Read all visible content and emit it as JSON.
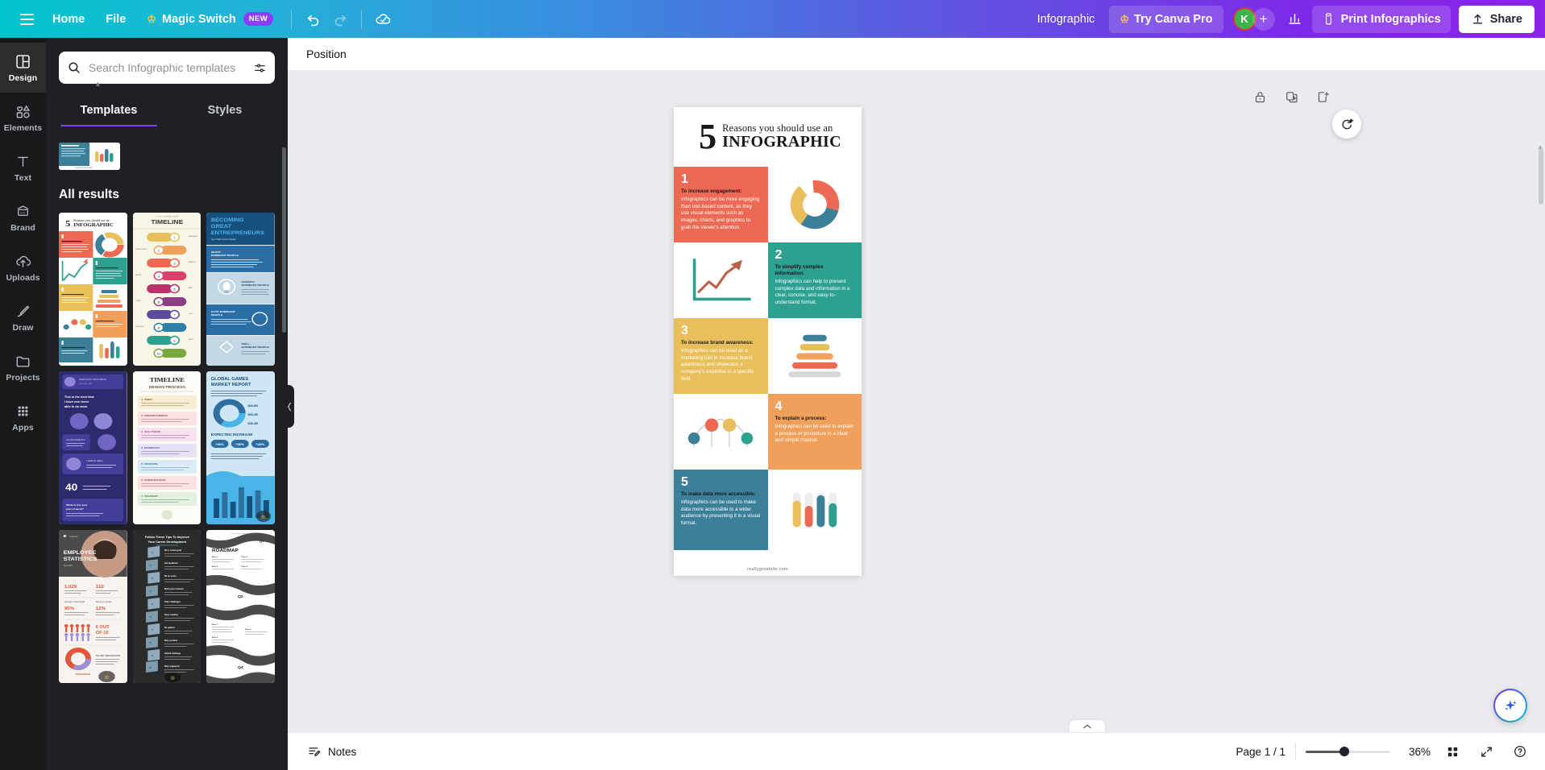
{
  "header": {
    "menu_icon": "hamburger-icon",
    "home_label": "Home",
    "file_label": "File",
    "magic_switch_label": "Magic Switch",
    "magic_switch_badge": "NEW",
    "undo_icon": "undo-icon",
    "redo_icon": "redo-icon",
    "cloud_saved_icon": "cloud-check-icon",
    "doc_title": "Infographic",
    "try_pro_label": "Try Canva Pro",
    "avatar_initial": "K",
    "add_collaborator_label": "+",
    "insights_icon": "bar-chart-icon",
    "print_label": "Print Infographics",
    "print_icon": "print-document-icon",
    "share_label": "Share",
    "share_icon": "upload-arrow-icon",
    "accent_purple": "#8b3dff",
    "accent_teal": "#00c4cc"
  },
  "sidebar": {
    "items": [
      {
        "label": "Design",
        "icon": "design-layout-icon",
        "active": true
      },
      {
        "label": "Elements",
        "icon": "shapes-icon",
        "active": false
      },
      {
        "label": "Text",
        "icon": "text-t-icon",
        "active": false
      },
      {
        "label": "Brand",
        "icon": "brand-card-icon",
        "active": false
      },
      {
        "label": "Uploads",
        "icon": "upload-cloud-icon",
        "active": false
      },
      {
        "label": "Draw",
        "icon": "pencil-draw-icon",
        "active": false
      },
      {
        "label": "Projects",
        "icon": "folder-icon",
        "active": false
      },
      {
        "label": "Apps",
        "icon": "apps-grid-icon",
        "active": false
      }
    ]
  },
  "panel": {
    "search": {
      "placeholder": "Search Infographic templates",
      "value": "",
      "icon": "search-icon",
      "filter_icon": "filter-sliders-icon"
    },
    "tabs": [
      {
        "label": "Templates",
        "active": true
      },
      {
        "label": "Styles",
        "active": false
      }
    ],
    "results_heading": "All results",
    "collapse_icon": "chevron-left-icon"
  },
  "toolbar": {
    "position_label": "Position"
  },
  "canvas": {
    "lock_icon": "lock-icon",
    "duplicate_icon": "duplicate-page-icon",
    "add_page_icon": "add-page-icon",
    "refresh_icon": "replace-refresh-icon",
    "magic_icon": "magic-sparkle-icon"
  },
  "infographic": {
    "title_prefix": "5",
    "title_line1": "Reasons you should use an",
    "title_line2": "INFOGRAPHIC",
    "website": "reallygreatsite.com",
    "sections": [
      {
        "number": "1",
        "heading": "To increase engagement:",
        "body": "Infographics can be more engaging than text-based content, as they use visual elements such as images, charts, and graphics to grab the viewer's attention.",
        "color": "#ec6a53",
        "side": "left",
        "graphic": "donut-chart"
      },
      {
        "number": "2",
        "heading": "To simplify complex information:",
        "body": "Infographics can help to present complex data and information in a clear, concise, and easy-to-understand format.",
        "color": "#2da090",
        "side": "right",
        "graphic": "line-arrow-chart"
      },
      {
        "number": "3",
        "heading": "To increase brand awareness:",
        "body": "Infographics can be used as a marketing tool to increase brand awareness and showcase a company's expertise in a specific field.",
        "color": "#e8bf5a",
        "side": "left",
        "graphic": "funnel-stack"
      },
      {
        "number": "4",
        "heading": "To explain a process:",
        "body": " Infographics can be used to explain a process or procedure in a clear and simple manner.",
        "color": "#f0a05a",
        "side": "right",
        "graphic": "connected-dots"
      },
      {
        "number": "5",
        "heading": "To make data more accessible:",
        "body": "Infographics can be used to make data more accessible to a wider audience by presenting it in a visual format.",
        "color": "#3c7f99",
        "side": "left",
        "graphic": "rounded-bars"
      }
    ]
  },
  "statusbar": {
    "notes_label": "Notes",
    "notes_icon": "notes-edit-icon",
    "page_count": "Page 1 / 1",
    "zoom_percent": "36%",
    "grid_icon": "grid-view-icon",
    "fullscreen_icon": "expand-fullscreen-icon",
    "help_icon": "help-question-icon",
    "expand_caret_icon": "chevron-up-icon"
  }
}
